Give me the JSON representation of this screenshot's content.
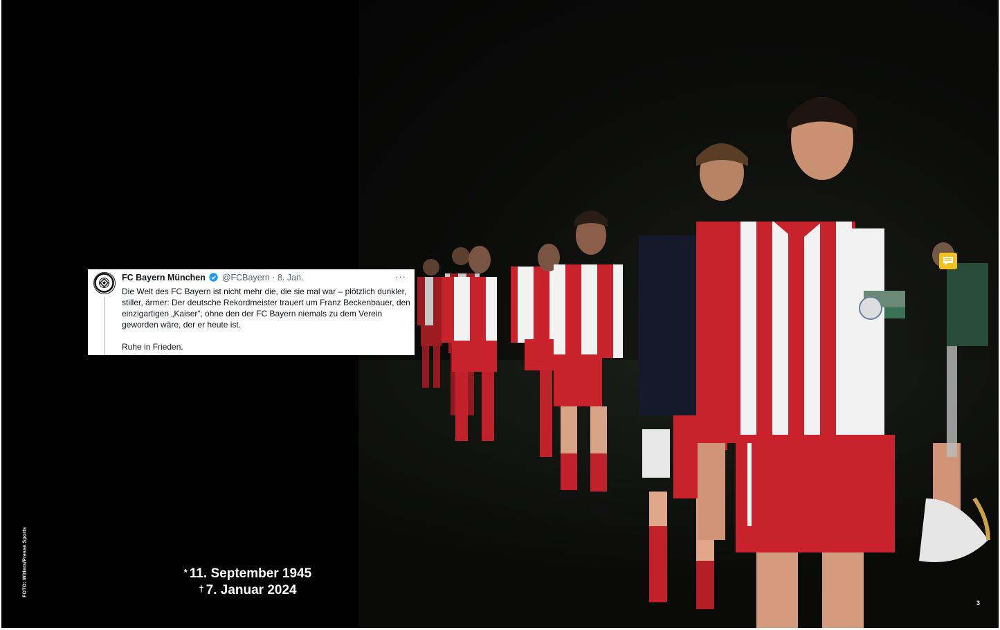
{
  "credit": "FOTO: Witters/Presse Sports",
  "dates": {
    "birth_symbol": "*",
    "birth": "11. September 1945",
    "death_symbol": "†",
    "death": "7. Januar 2024"
  },
  "page_number": "3",
  "tweet": {
    "name": "FC Bayern München",
    "handle": "@FCBayern",
    "separator": "·",
    "date": "8. Jan.",
    "more": "···",
    "text": "Die Welt des FC Bayern ist nicht mehr die, die sie mal war – plötzlich dunkler, stiller, ärmer: Der deutsche Rekordmeister trauert um Franz Beckenbauer, den einzigartigen „Kaiser“, ohne den der FC Bayern niemals zu dem Verein geworden wäre, der er heute ist.",
    "sign_off": "Ruhe in Frieden."
  },
  "colors": {
    "background": "#000000",
    "jersey_red": "#c8232c",
    "jersey_white": "#f2f2f2",
    "verified_blue": "#1d9bf0",
    "comment_yellow": "#f4c21b"
  },
  "icons": [
    "fc-bayern-logo-icon",
    "verified-badge-icon",
    "more-options-icon",
    "comment-icon"
  ]
}
